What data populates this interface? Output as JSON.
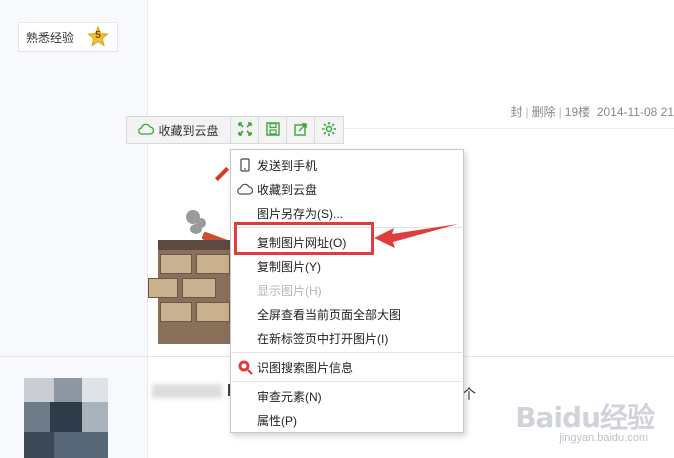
{
  "level_badge": {
    "text": "熟悉经验",
    "level": "5"
  },
  "post_meta": {
    "report": "封",
    "delete": "删除",
    "floor": "19楼",
    "datetime": "2014-11-08 21"
  },
  "image_toolbar": {
    "cloud_label": "收藏到云盘",
    "icons": [
      "cloud-icon",
      "expand-icon",
      "save-icon",
      "share-icon",
      "settings-icon"
    ]
  },
  "context_menu": {
    "items": [
      {
        "label": "发送到手机",
        "icon": "phone-icon",
        "enabled": true
      },
      {
        "label": "收藏到云盘",
        "icon": "cloud-icon",
        "enabled": true
      },
      {
        "label": "图片另存为(S)...",
        "enabled": true
      },
      {
        "label": "复制图片网址(O)",
        "enabled": true,
        "highlighted": true
      },
      {
        "label": "复制图片(Y)",
        "enabled": true
      },
      {
        "label": "显示图片(H)",
        "enabled": false
      },
      {
        "label": "全屏查看当前页面全部大图",
        "enabled": true
      },
      {
        "label": "在新标签页中打开图片(I)",
        "enabled": true
      },
      {
        "label": "识图搜索图片信息",
        "icon": "image-search-icon",
        "enabled": true
      },
      {
        "label": "审查元素(N)",
        "enabled": true
      },
      {
        "label": "属性(P)",
        "enabled": true
      }
    ]
  },
  "post_text_tail": "个",
  "watermark": {
    "brand": "Baidu经验",
    "url": "jingyan.baidu.com"
  },
  "colors": {
    "highlight": "#e23b3b",
    "toolbar_icon": "#3aa53a",
    "badge_star": "#f2c230"
  }
}
